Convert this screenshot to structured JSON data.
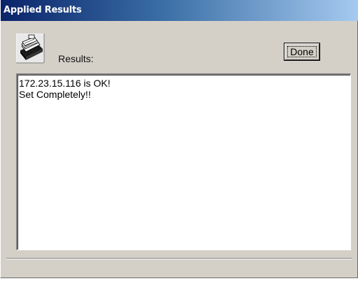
{
  "window": {
    "title": "Applied Results"
  },
  "header": {
    "icon": "card-file-icon",
    "results_label": "Results:",
    "done_label": "Done"
  },
  "results": {
    "lines": [
      "172.23.15.116 is OK!",
      "Set Completely!!"
    ]
  },
  "colors": {
    "title_bar_start": "#0a246a",
    "title_bar_end": "#a6caf0",
    "window_bg": "#d4d0c8"
  }
}
